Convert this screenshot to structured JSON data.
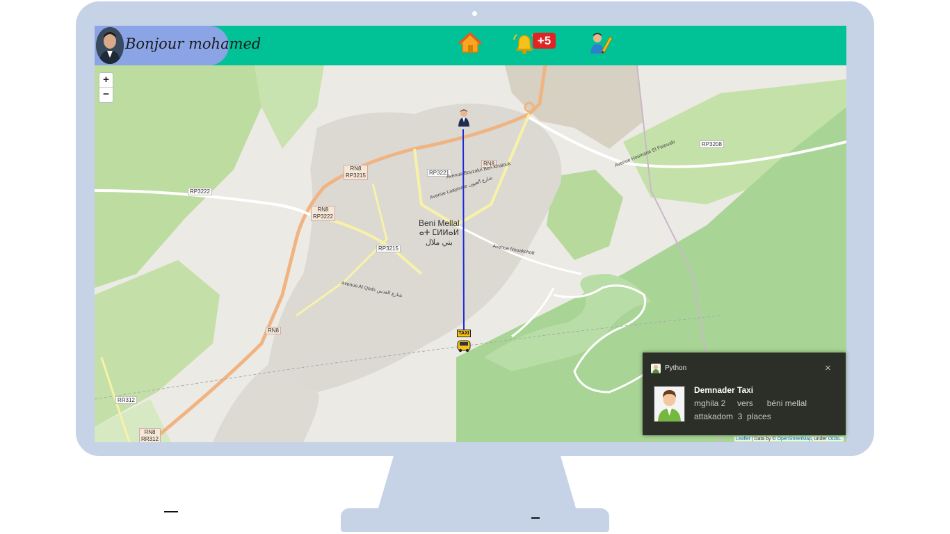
{
  "header": {
    "greeting": "Bonjour mohamed",
    "notification_badge": "+5",
    "icons": [
      "home-icon",
      "bell-icon",
      "edit-profile-icon"
    ],
    "colors": {
      "bar": "#00c296",
      "pill": "#8aa4e6",
      "badge": "#e02424"
    }
  },
  "map": {
    "zoom_in": "+",
    "zoom_out": "−",
    "city_name": "Beni Mellal",
    "city_name_tifinagh": "ⴰⵜ ⵎⵍⵍⴰⵍ",
    "city_name_arabic": "بني ملال",
    "road_labels": {
      "rn8_top": "RN8",
      "rp3221": "RP3221",
      "rp3208": "RP3208",
      "rn8_rp3215_a": "RN8",
      "rn8_rp3215_b": "RP3215",
      "rp3222_west": "RP3222",
      "rn8_rp3222_a": "RN8",
      "rn8_rp3222_b": "RP3222",
      "rp3215": "RP3215",
      "rn8_south": "RN8",
      "rr312": "RR312",
      "rn8_rr312_a": "RN8",
      "rn8_rr312_b": "RR312"
    },
    "street_labels": {
      "bouzakri": "Avenue Bouzakri Ben Khalouk",
      "laayoune": "Avenue Laayoune شارع العيون",
      "nouakchott": "Avenue Nouakchott",
      "al_qods": "Avenue Al Qods شارع القدس",
      "houmane": "Avenue Houmane El Fetouaki"
    },
    "markers": [
      "person-marker",
      "taxi-marker"
    ],
    "taxi_label": "TAXI",
    "attribution": {
      "leaflet": "Leaflet",
      "sep": " | Data by © ",
      "osm": "OpenStreetMap",
      "under": ", under ",
      "odbl": "ODbL."
    }
  },
  "toast": {
    "app_name": "Python",
    "close": "×",
    "title": "Demnader Taxi",
    "line1": "mghila 2     vers      béni mellal",
    "line2": "attakadom  3  places",
    "background": "#2b2f28"
  }
}
